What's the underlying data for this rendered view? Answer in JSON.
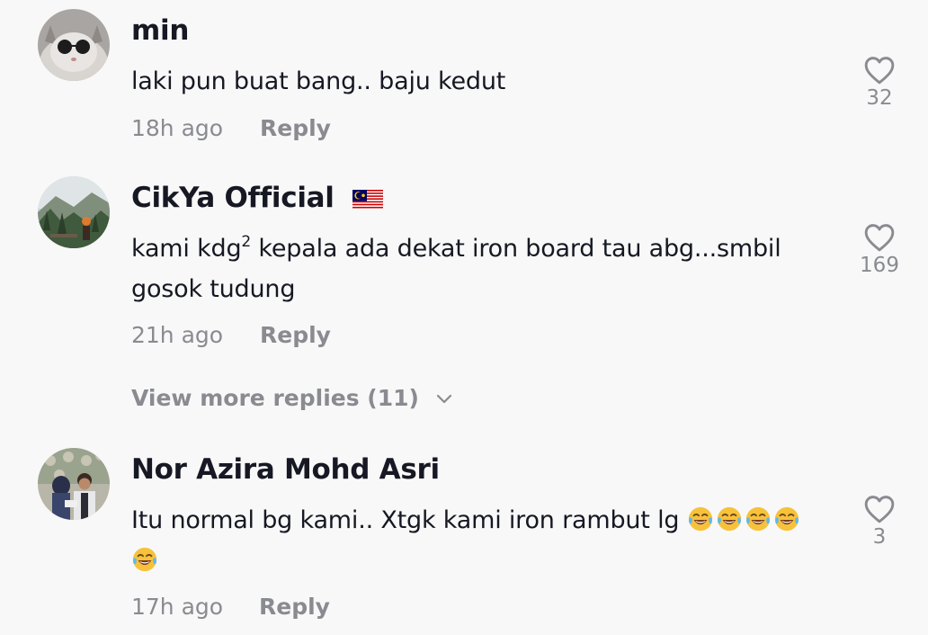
{
  "comments": [
    {
      "username": "min",
      "text": "laki pun buat bang.. baju kedut",
      "time": "18h ago",
      "reply_label": "Reply",
      "likes": "32",
      "avatar_icon": "cat-sunglasses-avatar"
    },
    {
      "username": "CikYa Official",
      "flag_icon": "malaysia-flag-icon",
      "text_before_sup": "kami kdg",
      "text_sup": "2",
      "text_after_sup": " kepala ada dekat iron board tau abg...smbil gosok tudung",
      "time": "21h ago",
      "reply_label": "Reply",
      "likes": "169",
      "avatar_icon": "landscape-photo-avatar"
    },
    {
      "username": "Nor Azira Mohd Asri",
      "text": "Itu normal bg kami.. Xtgk kami iron rambut lg ",
      "emoji_icon": "face-with-tears-of-joy-emoji",
      "time": "17h ago",
      "reply_label": "Reply",
      "likes": "3",
      "avatar_icon": "couple-photo-avatar"
    }
  ],
  "view_more_replies": "View more replies (11)",
  "colors": {
    "background": "#f8f8f8",
    "primary_text": "#161823",
    "secondary_text": "#8a8b91"
  }
}
